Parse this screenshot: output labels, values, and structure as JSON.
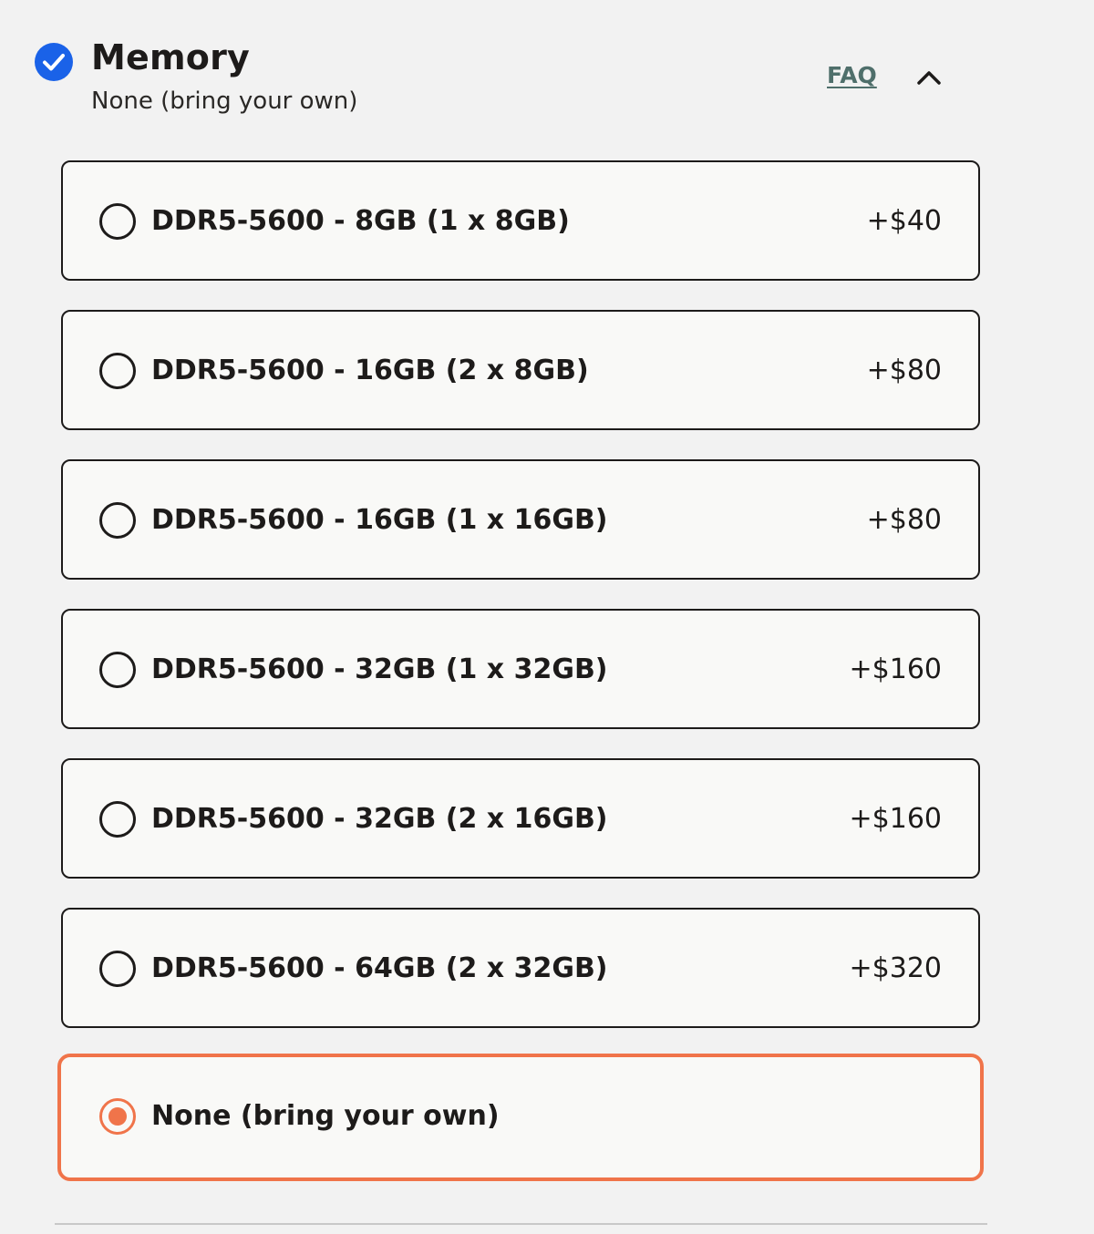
{
  "section": {
    "title": "Memory",
    "selected_summary": "None (bring your own)",
    "faq_label": "FAQ",
    "status_icon": "check-circle-icon",
    "toggle_icon": "chevron-up-icon"
  },
  "options": [
    {
      "label": "DDR5-5600 - 8GB (1 x 8GB)",
      "price": "+$40",
      "selected": false
    },
    {
      "label": "DDR5-5600 - 16GB (2 x 8GB)",
      "price": "+$80",
      "selected": false
    },
    {
      "label": "DDR5-5600 - 16GB (1 x 16GB)",
      "price": "+$80",
      "selected": false
    },
    {
      "label": "DDR5-5600 - 32GB (1 x 32GB)",
      "price": "+$160",
      "selected": false
    },
    {
      "label": "DDR5-5600 - 32GB (2 x 16GB)",
      "price": "+$160",
      "selected": false
    },
    {
      "label": "DDR5-5600 - 64GB (2 x 32GB)",
      "price": "+$320",
      "selected": false
    },
    {
      "label": "None (bring your own)",
      "price": "",
      "selected": true
    }
  ],
  "colors": {
    "accent": "#f0744a",
    "check": "#1a62e8",
    "faq": "#4f6f6b",
    "border": "#1d1b1a",
    "background": "#f2f2f2",
    "card": "#f9f9f7"
  }
}
